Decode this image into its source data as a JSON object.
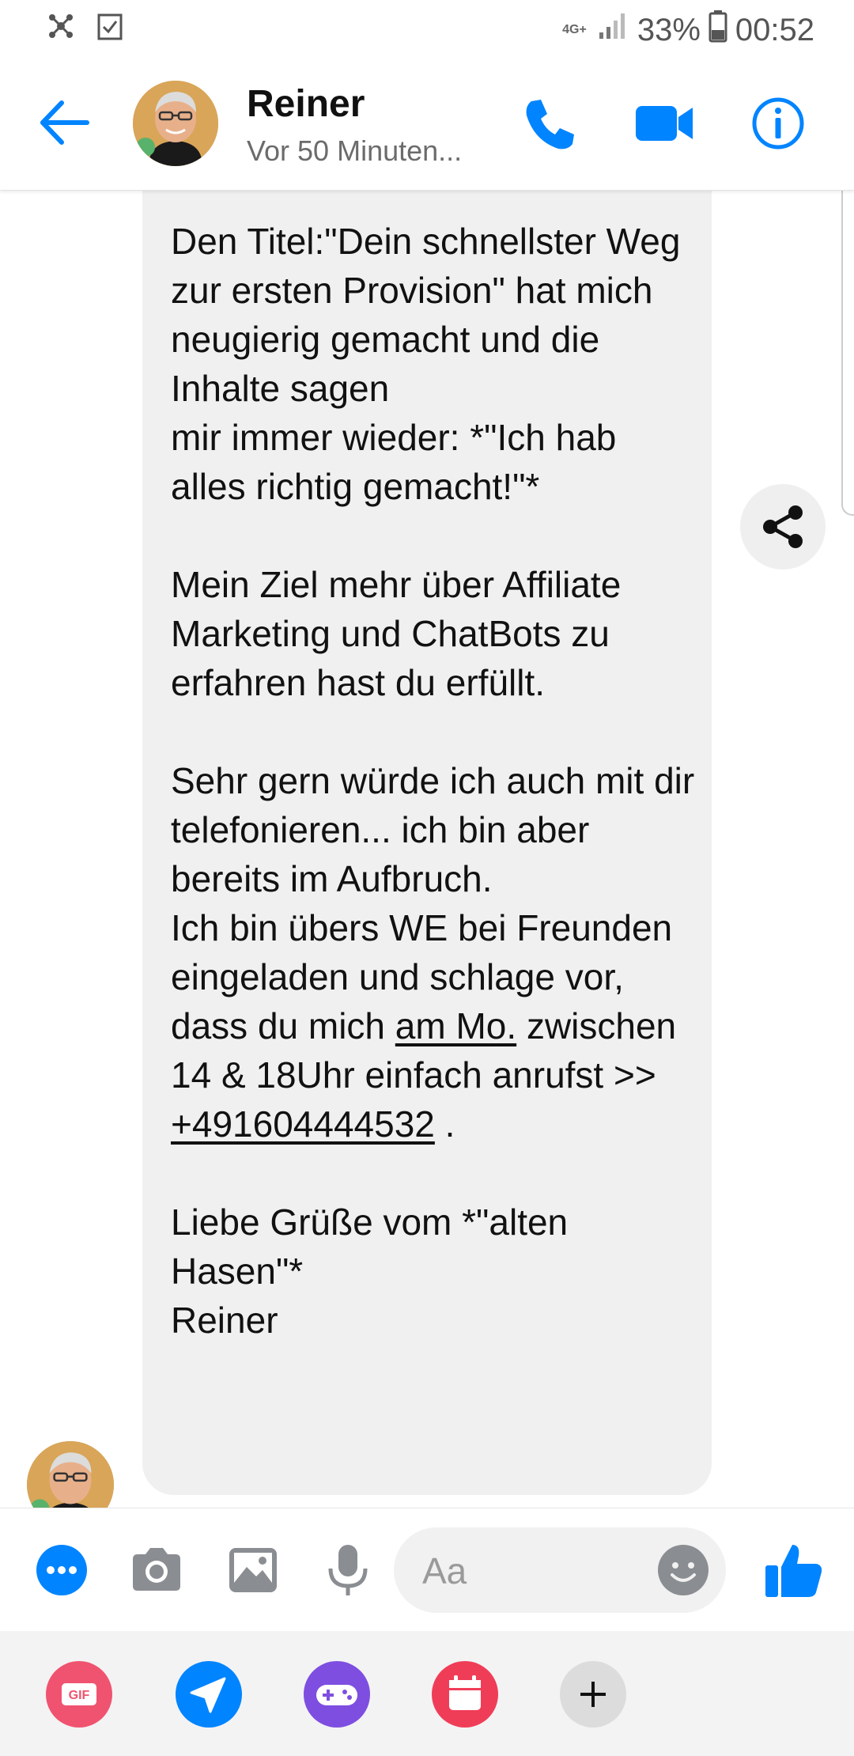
{
  "status_bar": {
    "network": "4G+",
    "battery": "33%",
    "time": "00:52",
    "left_icons": [
      "app-network-icon",
      "checkbox-icon"
    ]
  },
  "header": {
    "contact_name": "Reiner",
    "contact_status": "Vor 50 Minuten...",
    "icons": [
      "back-arrow-icon",
      "phone-icon",
      "video-camera-icon",
      "info-icon"
    ]
  },
  "message": {
    "p1": "Den Titel:\"Dein schnellster Weg zur ersten Provision\" hat mich neugierig gemacht und die Inhalte sagen\nmir immer wieder: *\"Ich hab alles richtig gemacht!\"*",
    "p2": "Mein Ziel mehr über Affiliate Marketing und ChatBots zu erfahren hast du erfüllt.",
    "p3": "Sehr gern würde ich auch mit dir telefonieren... ich bin aber bereits im Aufbruch.\nIch bin übers WE bei Freunden eingeladen und schlage vor, dass du mich ",
    "link_day": "am Mo.",
    "p3b": " zwischen\n14 & 18Uhr einfach anrufst >> ",
    "link_phone": "+491604444532",
    "p3c": " .",
    "p4": "Liebe Grüße vom *\"alten Hasen\"*\nReiner"
  },
  "composer": {
    "placeholder": "Aa",
    "icons": [
      "more-icon",
      "camera-icon",
      "gallery-icon",
      "microphone-icon",
      "emoji-icon",
      "thumbs-up-icon"
    ]
  },
  "tray": {
    "gif_label": "GIF",
    "icons": [
      "gif-icon",
      "location-arrow-icon",
      "game-controller-icon",
      "calendar-icon",
      "plus-icon"
    ]
  },
  "colors": {
    "messenger_blue": "#0084ff",
    "bubble_gray": "#f0f0f0",
    "gif_pink": "#f0536f",
    "game_purple": "#7e4ee0",
    "calendar_red": "#f03d57"
  }
}
